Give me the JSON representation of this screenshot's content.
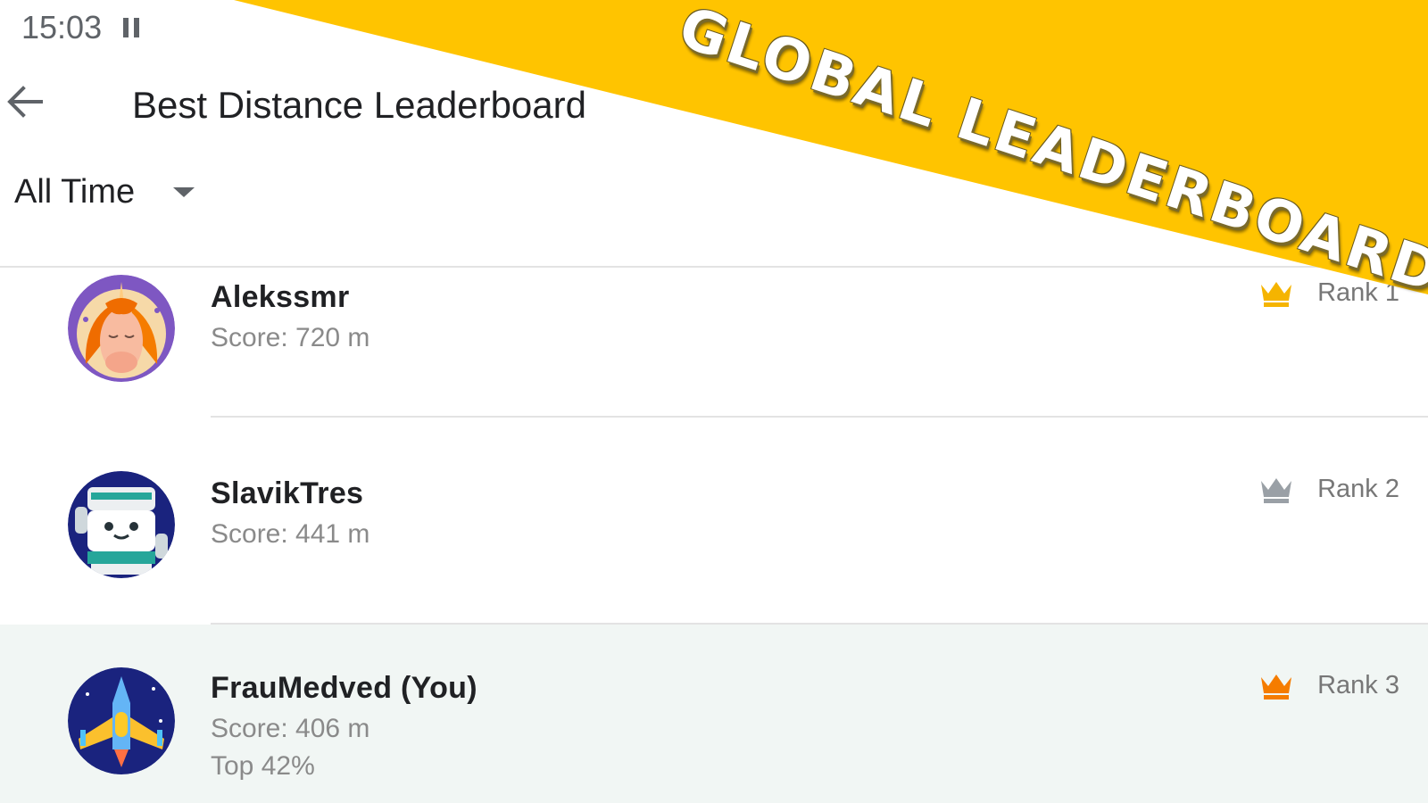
{
  "status_bar": {
    "time": "15:03",
    "media_icon": "pause-icon"
  },
  "app_bar": {
    "back_icon": "arrow-left-icon",
    "title": "Best Distance Leaderboard"
  },
  "filter": {
    "selected": "All Time",
    "icon": "chevron-down-icon"
  },
  "banner": {
    "text": "GLOBAL LEADERBOARD!",
    "color": "#FFC400"
  },
  "entries": [
    {
      "name": "Alekssmr",
      "score": "Score: 720 m",
      "rank": "Rank 1",
      "crown_color": "#F5B400",
      "avatar": "unicorn-avatar"
    },
    {
      "name": "SlavikTres",
      "score": "Score: 441 m",
      "rank": "Rank 2",
      "crown_color": "#9AA0A6",
      "avatar": "robot-avatar"
    },
    {
      "name": "FrauMedved (You)",
      "score": "Score: 406 m",
      "extra": "Top 42%",
      "rank": "Rank 3",
      "crown_color": "#F57C00",
      "avatar": "spaceship-avatar",
      "highlighted": true
    }
  ]
}
